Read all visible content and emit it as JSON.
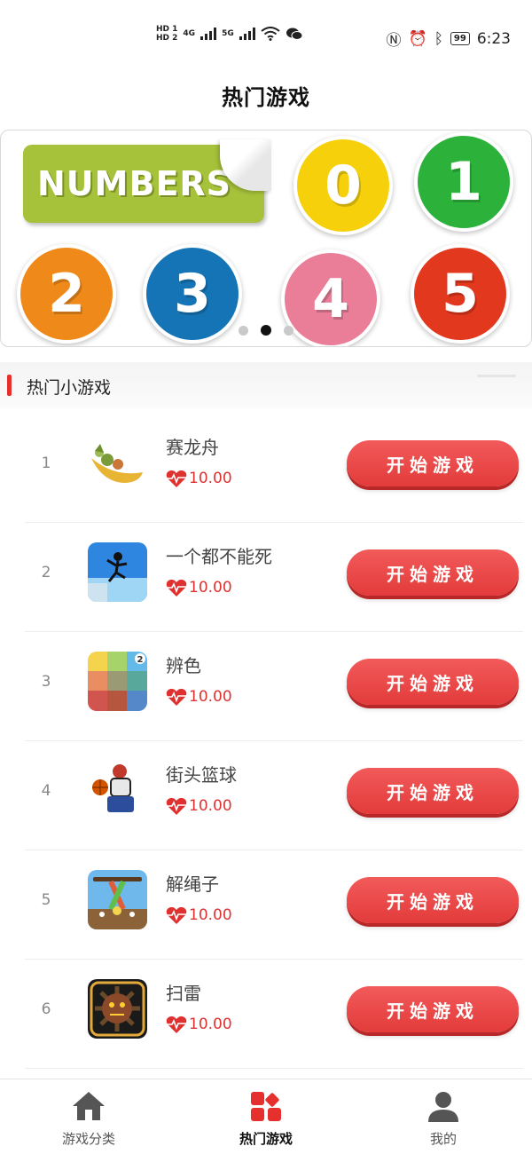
{
  "status_bar": {
    "hd_top": "HD 1",
    "hd_bottom": "HD 2",
    "net1": "4G",
    "net2": "5G",
    "battery": "99",
    "time": "6:23",
    "icons": [
      "nfc-icon",
      "alarm-icon",
      "bluetooth-icon",
      "wifi-icon",
      "wechat-icon"
    ]
  },
  "header": {
    "title": "热门游戏"
  },
  "banner": {
    "tag_text": "NUMBERS",
    "numbers": [
      "0",
      "1",
      "2",
      "3",
      "4",
      "5"
    ],
    "page_count": 3,
    "active_page": 2
  },
  "section": {
    "title": "热门小游戏"
  },
  "games": [
    {
      "rank": "1",
      "name": "赛龙舟",
      "price": "10.00",
      "button": "开始游戏",
      "icon": "dragon-boat-icon"
    },
    {
      "rank": "2",
      "name": "一个都不能死",
      "price": "10.00",
      "button": "开始游戏",
      "icon": "stickman-icon"
    },
    {
      "rank": "3",
      "name": "辨色",
      "price": "10.00",
      "button": "开始游戏",
      "icon": "color-grid-icon"
    },
    {
      "rank": "4",
      "name": "街头篮球",
      "price": "10.00",
      "button": "开始游戏",
      "icon": "basketball-player-icon"
    },
    {
      "rank": "5",
      "name": "解绳子",
      "price": "10.00",
      "button": "开始游戏",
      "icon": "rope-icon"
    },
    {
      "rank": "6",
      "name": "扫雷",
      "price": "10.00",
      "button": "开始游戏",
      "icon": "mine-icon"
    }
  ],
  "tabs": [
    {
      "label": "游戏分类",
      "icon": "home-icon",
      "active": false
    },
    {
      "label": "热门游戏",
      "icon": "grid-icon",
      "active": true
    },
    {
      "label": "我的",
      "icon": "user-icon",
      "active": false
    }
  ],
  "colors": {
    "accent": "#e5302e",
    "button": "#e33b3b",
    "price": "#e03131"
  }
}
